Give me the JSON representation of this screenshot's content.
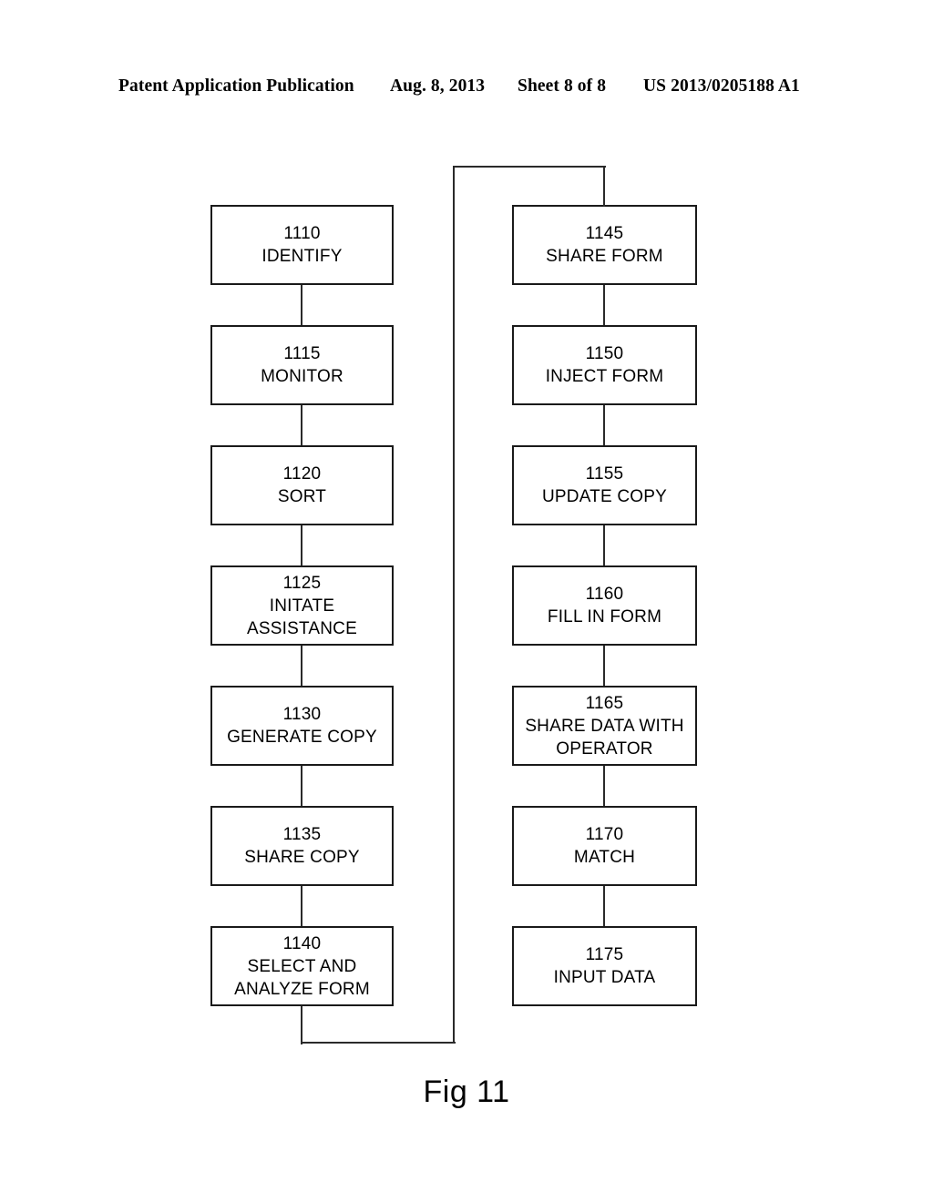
{
  "header": {
    "publication": "Patent Application Publication",
    "date": "Aug. 8, 2013",
    "sheet": "Sheet 8 of 8",
    "document_number": "US 2013/0205188 A1"
  },
  "figure": {
    "caption": "Fig 11",
    "type": "flowchart",
    "line_color": "#1a1a1a",
    "fill_color": "#ffffff"
  },
  "flowchart": {
    "left_column": [
      {
        "ref": "1110",
        "label": "IDENTIFY"
      },
      {
        "ref": "1115",
        "label": "MONITOR"
      },
      {
        "ref": "1120",
        "label": "SORT"
      },
      {
        "ref": "1125",
        "label": "INITATE\nASSISTANCE"
      },
      {
        "ref": "1130",
        "label": "GENERATE COPY"
      },
      {
        "ref": "1135",
        "label": "SHARE COPY"
      },
      {
        "ref": "1140",
        "label": "SELECT AND\nANALYZE FORM"
      }
    ],
    "right_column": [
      {
        "ref": "1145",
        "label": "SHARE FORM"
      },
      {
        "ref": "1150",
        "label": "INJECT FORM"
      },
      {
        "ref": "1155",
        "label": "UPDATE COPY"
      },
      {
        "ref": "1160",
        "label": "FILL IN FORM"
      },
      {
        "ref": "1165",
        "label": "SHARE DATA WITH\nOPERATOR"
      },
      {
        "ref": "1170",
        "label": "MATCH"
      },
      {
        "ref": "1175",
        "label": "INPUT DATA"
      }
    ]
  }
}
